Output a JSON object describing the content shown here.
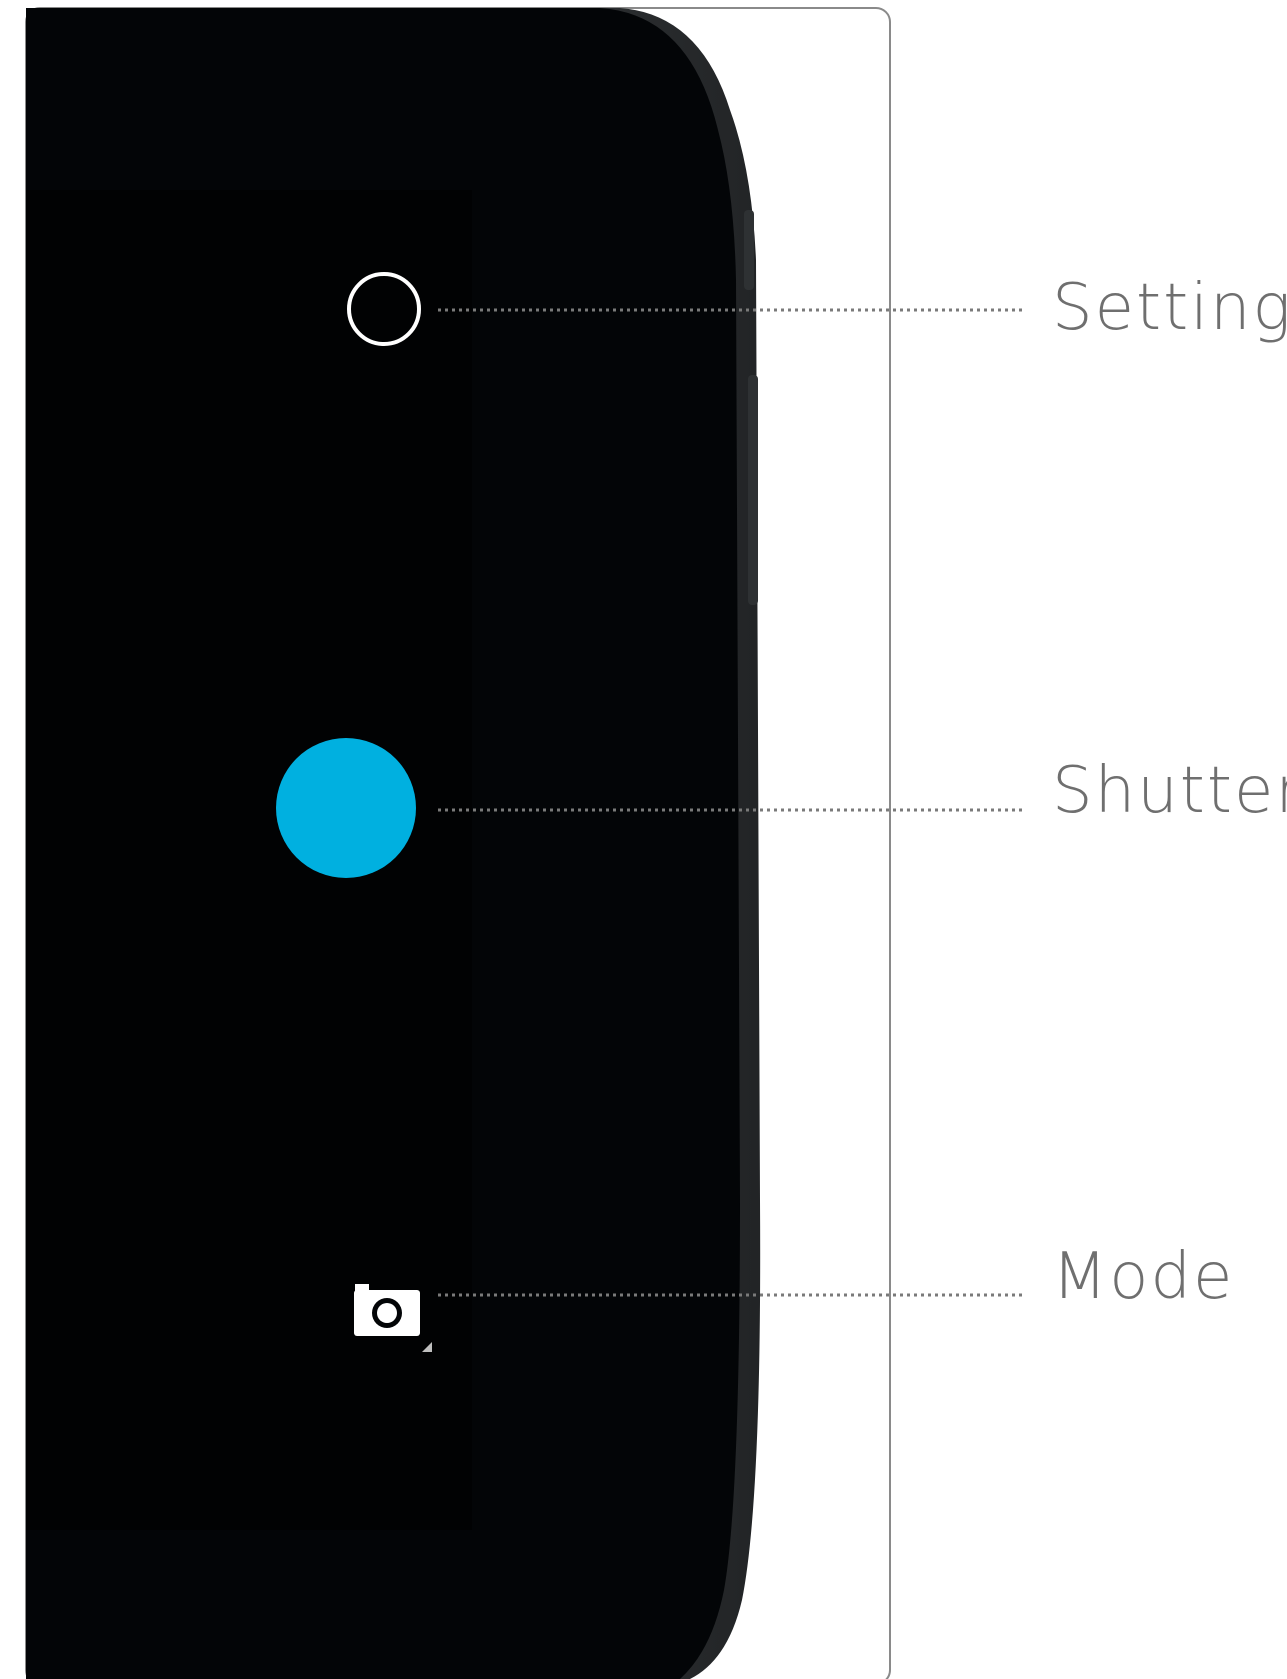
{
  "callouts": {
    "settings": "Settings",
    "shutter": "Shutter",
    "mode": "Mode"
  },
  "icons": {
    "settings_control": "ring-icon",
    "shutter_control": "shutter-circle",
    "mode_control": "camera-icon"
  },
  "colors": {
    "shutter": "#00b0e0",
    "screen": "#030507",
    "device_body": "#2b2e30",
    "label": "#6f6f6f",
    "leader": "#7a7a7a"
  }
}
